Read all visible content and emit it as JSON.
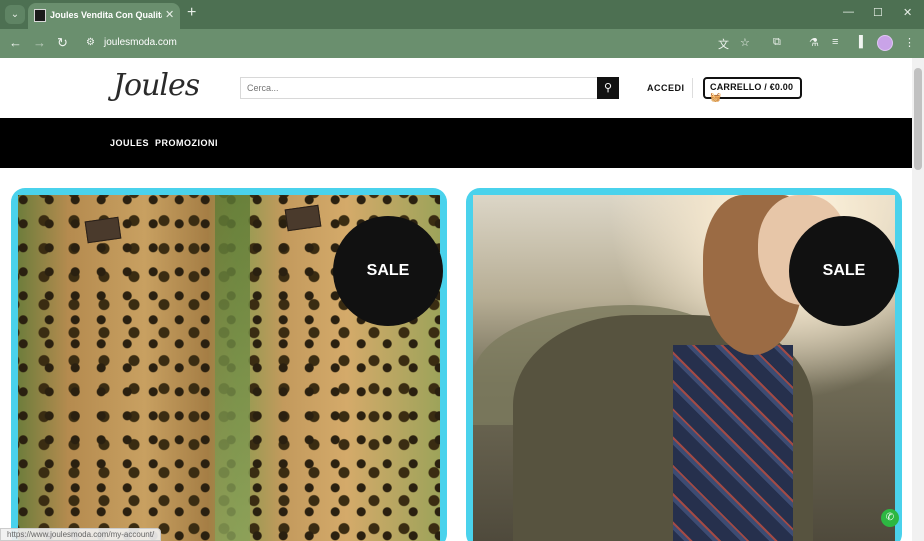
{
  "browser": {
    "tab_title": "Joules Vendita Con Qualità Affi",
    "url": "joulesmoda.com",
    "icons": {
      "tab_menu": "chevron-down-icon",
      "close_tab": "close-icon",
      "new_tab": "plus-icon",
      "back": "arrow-left-icon",
      "forward": "arrow-right-icon",
      "reload": "reload-icon",
      "translate": "translate-icon",
      "bookmark": "star-icon",
      "extensions": "puzzle-icon",
      "labs": "flask-icon",
      "queue": "list-icon",
      "sidebar": "sidebar-icon",
      "menu": "kebab-icon"
    }
  },
  "site": {
    "logo_text": "Joules",
    "search_placeholder": "Cerca...",
    "login_label": "ACCEDI",
    "cart_label": "CARRELLO / €0.00",
    "nav": [
      "JOULES",
      "PROMOZIONI"
    ]
  },
  "cards": [
    {
      "badge": "SALE"
    },
    {
      "badge": "SALE"
    }
  ],
  "status_url": "https://www.joulesmoda.com/my-account/",
  "colors": {
    "accent_border": "#4ad2ec",
    "nav_bg": "#000000",
    "tab_bar": "#4d7052",
    "toolbar": "#6a8f6e"
  }
}
